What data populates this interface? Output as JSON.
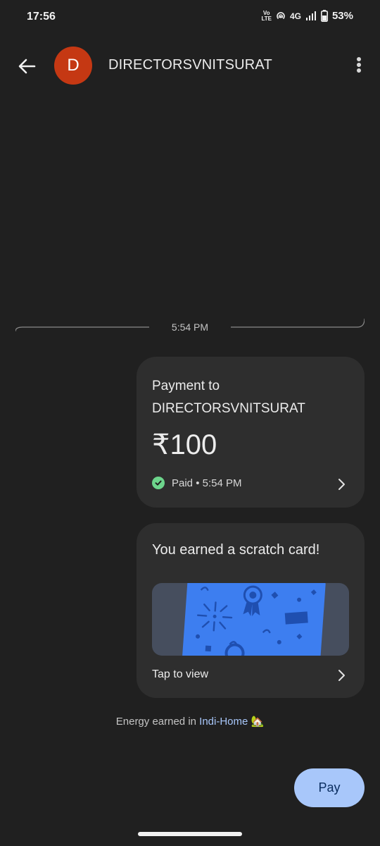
{
  "status_bar": {
    "time": "17:56",
    "volte_top": "Vo",
    "volte_bottom": "LTE",
    "network": "4G",
    "battery": "53%"
  },
  "header": {
    "avatar_letter": "D",
    "contact_name": "DIRECTORSVNITSURAT",
    "back_icon": "arrow-back-icon",
    "menu_icon": "more-vert-icon"
  },
  "conversation": {
    "divider_time": "5:54 PM",
    "payment": {
      "title_line1": "Payment to",
      "title_line2": "DIRECTORSVNITSURAT",
      "amount": "₹100",
      "status": "Paid • 5:54 PM",
      "status_color": "#6dd58c"
    },
    "scratch": {
      "title": "You earned a scratch card!",
      "action": "Tap to view",
      "card_color": "#3d7ef0"
    },
    "energy": {
      "prefix": "Energy earned in ",
      "link": "Indi-Home",
      "emoji": "🏡"
    }
  },
  "actions": {
    "pay_label": "Pay"
  },
  "colors": {
    "background": "#202020",
    "card": "#2e2e2e",
    "accent": "#a8c7fa",
    "avatar": "#c53813"
  }
}
